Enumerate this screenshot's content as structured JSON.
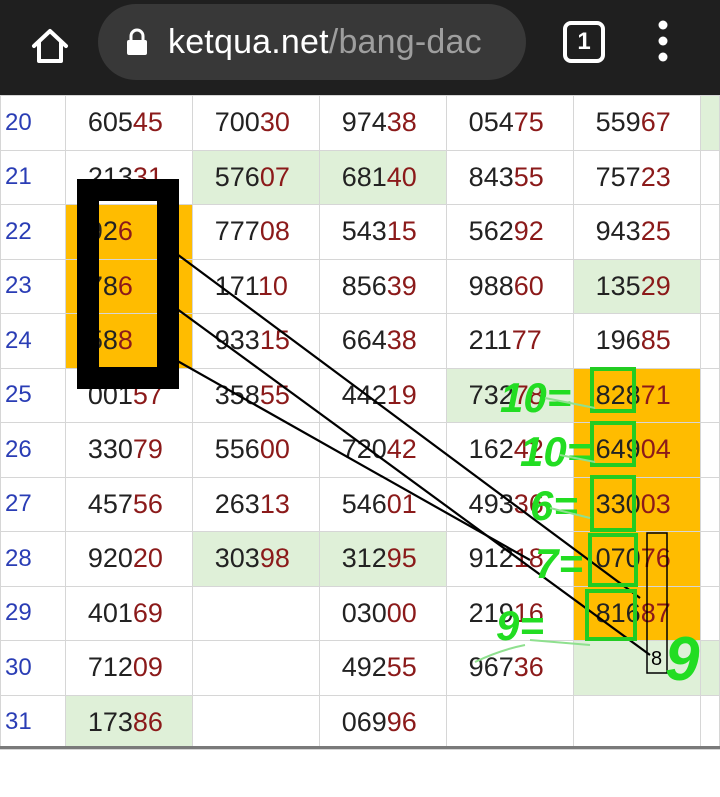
{
  "browser": {
    "url_domain": "ketqua.net",
    "url_path": "/bang-dac",
    "tab_count": "1"
  },
  "table": {
    "rows": [
      {
        "day": "20",
        "cells": [
          [
            "605",
            "45"
          ],
          [
            "700",
            "30"
          ],
          [
            "974",
            "38"
          ],
          [
            "054",
            "75"
          ],
          [
            "559",
            "67"
          ]
        ]
      },
      {
        "day": "21",
        "cells": [
          [
            "213",
            "31"
          ],
          [
            "576",
            "07"
          ],
          [
            "681",
            "40"
          ],
          [
            "843",
            "55"
          ],
          [
            "757",
            "23"
          ]
        ]
      },
      {
        "day": "22",
        "cells": [
          [
            "92",
            "6"
          ],
          [
            "777",
            "08"
          ],
          [
            "543",
            "15"
          ],
          [
            "562",
            "92"
          ],
          [
            "943",
            "25"
          ]
        ]
      },
      {
        "day": "23",
        "cells": [
          [
            "78",
            "6"
          ],
          [
            "171",
            "10"
          ],
          [
            "856",
            "39"
          ],
          [
            "988",
            "60"
          ],
          [
            "135",
            "29"
          ]
        ]
      },
      {
        "day": "24",
        "cells": [
          [
            "58",
            "8"
          ],
          [
            "933",
            "15"
          ],
          [
            "664",
            "38"
          ],
          [
            "211",
            "77"
          ],
          [
            "196",
            "85"
          ]
        ]
      },
      {
        "day": "25",
        "cells": [
          [
            "001",
            "57"
          ],
          [
            "358",
            "55"
          ],
          [
            "442",
            "19"
          ],
          [
            "732",
            "78"
          ],
          [
            "828",
            "71"
          ]
        ]
      },
      {
        "day": "26",
        "cells": [
          [
            "330",
            "79"
          ],
          [
            "556",
            "00"
          ],
          [
            "720",
            "42"
          ],
          [
            "162",
            "42"
          ],
          [
            "649",
            "04"
          ]
        ]
      },
      {
        "day": "27",
        "cells": [
          [
            "457",
            "56"
          ],
          [
            "263",
            "13"
          ],
          [
            "546",
            "01"
          ],
          [
            "493",
            "36"
          ],
          [
            "330",
            "03"
          ]
        ]
      },
      {
        "day": "28",
        "cells": [
          [
            "920",
            "20"
          ],
          [
            "303",
            "98"
          ],
          [
            "312",
            "95"
          ],
          [
            "912",
            "18"
          ],
          [
            "070",
            "76"
          ]
        ]
      },
      {
        "day": "29",
        "cells": [
          [
            "401",
            "69"
          ],
          [
            "",
            ""
          ],
          [
            "030",
            "00"
          ],
          [
            "219",
            "16"
          ],
          [
            "816",
            "87"
          ]
        ]
      },
      {
        "day": "30",
        "cells": [
          [
            "712",
            "09"
          ],
          [
            "",
            ""
          ],
          [
            "492",
            "55"
          ],
          [
            "967",
            "36"
          ],
          [
            "",
            ""
          ]
        ]
      },
      {
        "day": "31",
        "cells": [
          [
            "173",
            "86"
          ],
          [
            "",
            ""
          ],
          [
            "069",
            "96"
          ],
          [
            "",
            ""
          ],
          [
            "",
            ""
          ]
        ]
      }
    ]
  },
  "annotations": {
    "handwritten": [
      "10=",
      "10=",
      "6=",
      "7=",
      "9=",
      "9"
    ],
    "column_digit": "8",
    "colors": {
      "ink": "#22dd22",
      "box": "#22cc22",
      "line": "#000000"
    }
  }
}
